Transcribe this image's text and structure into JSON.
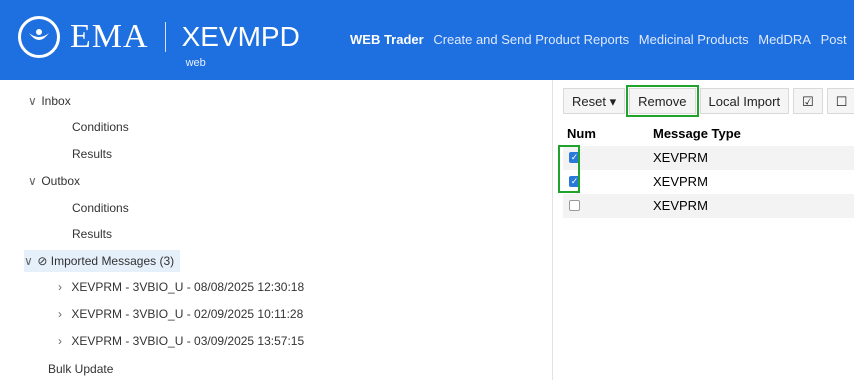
{
  "header": {
    "logo": "EMA",
    "app_name": "XEVMPD",
    "app_sub": "web",
    "nav": [
      "WEB Trader",
      "Create and Send Product Reports",
      "Medicinal Products",
      "MedDRA",
      "Post"
    ]
  },
  "tree": {
    "inbox": "Inbox",
    "inbox_conditions": "Conditions",
    "inbox_results": "Results",
    "outbox": "Outbox",
    "outbox_conditions": "Conditions",
    "outbox_results": "Results",
    "imported": "Imported Messages (3)",
    "messages": [
      "XEVPRM - 3VBIO_U - 08/08/2025 12:30:18",
      "XEVPRM - 3VBIO_U - 02/09/2025 10:11:28",
      "XEVPRM - 3VBIO_U - 03/09/2025 13:57:15"
    ],
    "bulk_update": "Bulk Update"
  },
  "toolbar": {
    "reset": "Reset ▾",
    "remove": "Remove",
    "local_import": "Local Import"
  },
  "table": {
    "columns": [
      "Num",
      "Message Type"
    ],
    "rows": [
      {
        "checked": true,
        "type": "XEVPRM"
      },
      {
        "checked": true,
        "type": "XEVPRM"
      },
      {
        "checked": false,
        "type": "XEVPRM"
      }
    ]
  },
  "colors": {
    "header": "#1e6fe0",
    "highlight": "#20a32d",
    "checkbox": "#2979d9"
  }
}
